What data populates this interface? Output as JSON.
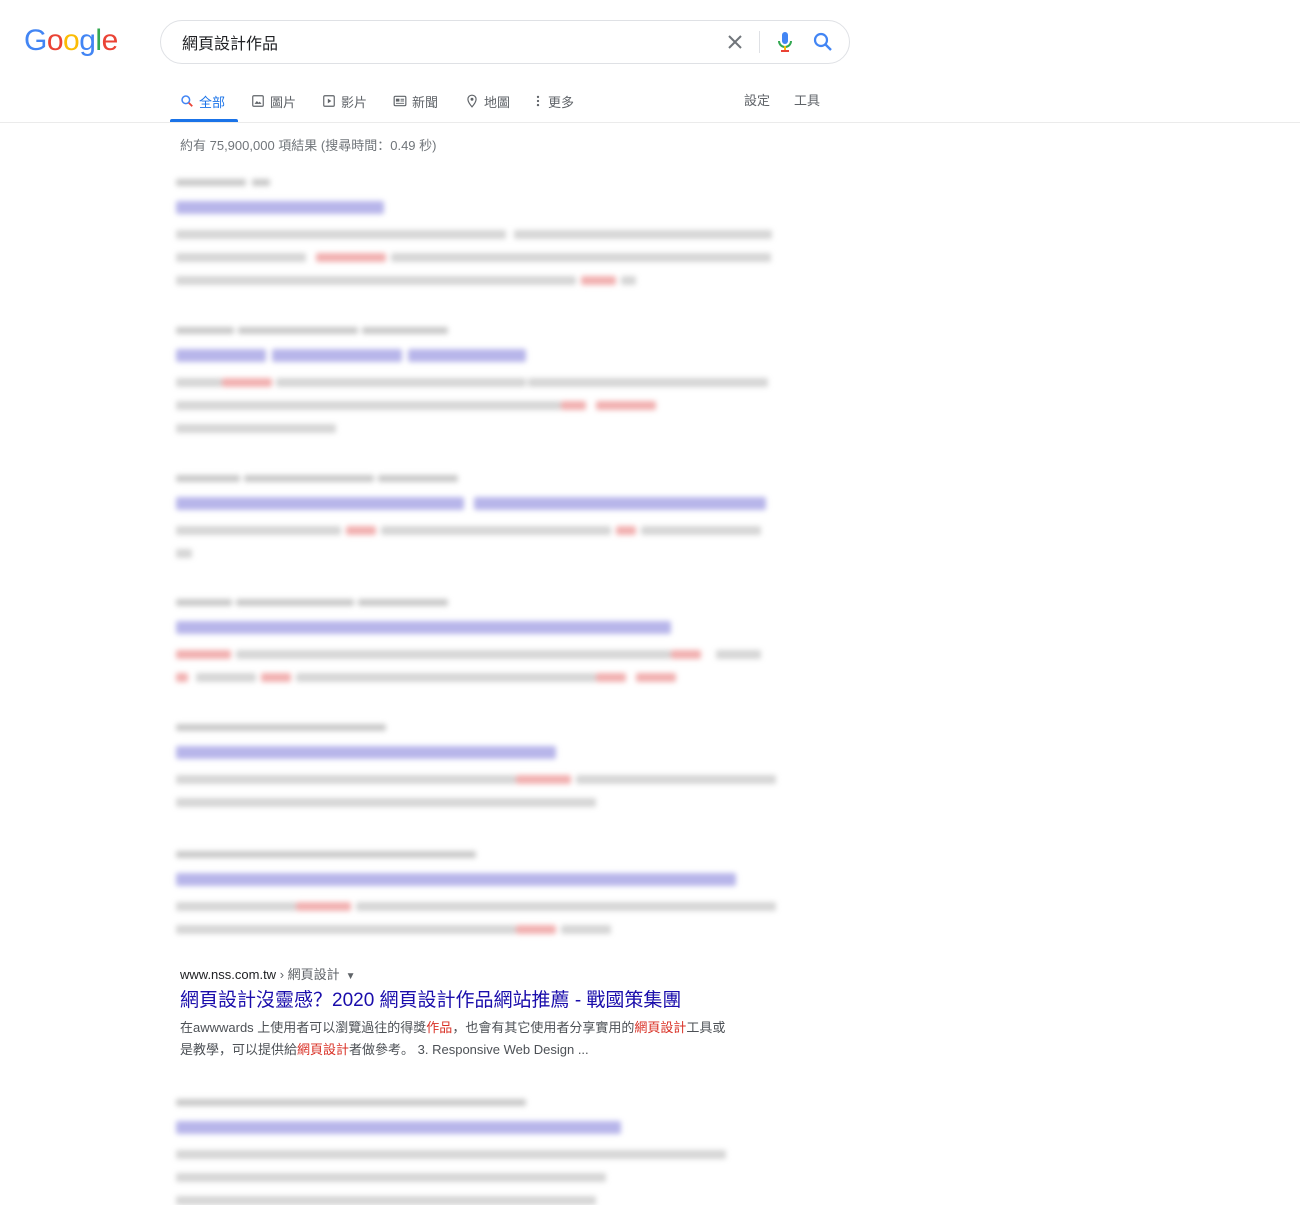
{
  "logo": {
    "letters": [
      {
        "ch": "G",
        "color": "#4285f4"
      },
      {
        "ch": "o",
        "color": "#ea4335"
      },
      {
        "ch": "o",
        "color": "#fbbc05"
      },
      {
        "ch": "g",
        "color": "#4285f4"
      },
      {
        "ch": "l",
        "color": "#34a853"
      },
      {
        "ch": "e",
        "color": "#ea4335"
      }
    ]
  },
  "search": {
    "query": "網頁設計作品"
  },
  "tabs": [
    {
      "label": "全部",
      "icon": "search-icon",
      "active": true
    },
    {
      "label": "圖片",
      "icon": "image-icon"
    },
    {
      "label": "影片",
      "icon": "video-icon"
    },
    {
      "label": "新聞",
      "icon": "news-icon"
    },
    {
      "label": "地圖",
      "icon": "map-pin-icon"
    },
    {
      "label": "更多",
      "icon": "more-vert-icon"
    }
  ],
  "tools": {
    "settings": "設定",
    "tools": "工具"
  },
  "stats": "約有 75,900,000 項結果 (搜尋時間：0.49 秒)",
  "visible_result": {
    "cite_domain": "www.nss.com.tw",
    "cite_path": " › 網頁設計",
    "title": "網頁設計沒靈感？2020 網頁設計作品網站推薦 - 戰國策集團",
    "snippet_line1": [
      {
        "t": "在awwwards 上使用者可以瀏覽過往的得獎"
      },
      {
        "t": "作品",
        "em": true
      },
      {
        "t": "，也會有其它使用者分享實用的"
      },
      {
        "t": "網頁設計",
        "em": true
      },
      {
        "t": "工具或"
      }
    ],
    "snippet_line2": [
      {
        "t": "是教學，可以提供給"
      },
      {
        "t": "網頁設計",
        "em": true
      },
      {
        "t": "者做參考。 3. Responsive Web Design ..."
      }
    ]
  },
  "colors": {
    "link": "#1a0dab",
    "accent": "#1a73e8",
    "emphasis": "#d93025",
    "mic_blue": "#4285f4",
    "mic_red": "#ea4335",
    "mic_yellow": "#fbbc05",
    "mic_green": "#34a853"
  }
}
